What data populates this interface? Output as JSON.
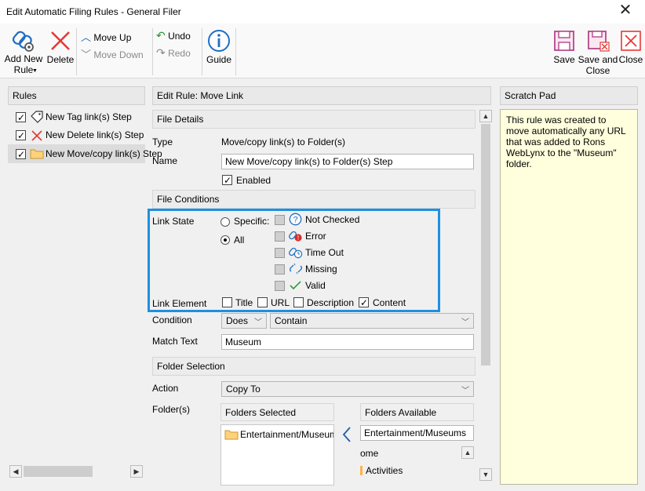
{
  "window": {
    "title": "Edit Automatic Filing Rules - General Filer"
  },
  "ribbon": {
    "add_new_rule": "Add New\nRule",
    "delete": "Delete",
    "move_up": "Move Up",
    "move_down": "Move Down",
    "undo": "Undo",
    "redo": "Redo",
    "guide": "Guide",
    "save": "Save",
    "save_and_close": "Save and\nClose",
    "close": "Close"
  },
  "rules": {
    "header": "Rules",
    "items": [
      {
        "label": "New Tag link(s) Step",
        "checked": true
      },
      {
        "label": "New Delete link(s) Step",
        "checked": true
      },
      {
        "label": "New Move/copy link(s) Step",
        "checked": true,
        "selected": true
      }
    ]
  },
  "edit": {
    "header": "Edit Rule: Move Link",
    "file_details": "File Details",
    "type_label": "Type",
    "type_value": "Move/copy link(s) to Folder(s)",
    "name_label": "Name",
    "name_value": "New Move/copy link(s) to Folder(s) Step",
    "enabled": "Enabled",
    "file_conditions": "File Conditions",
    "link_state": "Link State",
    "specific": "Specific:",
    "all": "All",
    "states": [
      "Not Checked",
      "Error",
      "Time Out",
      "Missing",
      "Valid"
    ],
    "link_element": "Link Element",
    "elements": [
      {
        "label": "Title",
        "checked": false
      },
      {
        "label": "URL",
        "checked": false
      },
      {
        "label": "Description",
        "checked": false
      },
      {
        "label": "Content",
        "checked": true
      }
    ],
    "condition_label": "Condition",
    "condition_does": "Does",
    "condition_op": "Contain",
    "match_label": "Match Text",
    "match_value": "Museum",
    "folder_selection": "Folder Selection",
    "action_label": "Action",
    "action_value": "Copy To",
    "folders_label": "Folder(s)",
    "folders_selected": "Folders Selected",
    "folders_available": "Folders Available",
    "selected_item": "Entertainment/Museums",
    "available_search": "Entertainment/Museums",
    "available_items": [
      "ome",
      "Activities"
    ]
  },
  "scratch": {
    "header": "Scratch Pad",
    "text": "This rule was created to move automatically any URL that was added to Rons WebLynx to the \"Museum\" folder."
  },
  "colors": {
    "highlight_border": "#1e90e0",
    "scratch_bg": "#ffffdd"
  }
}
